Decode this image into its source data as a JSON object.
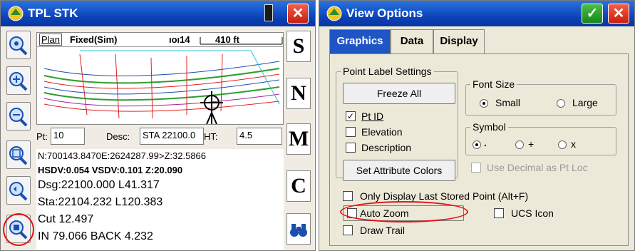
{
  "left": {
    "title": "TPL STK",
    "close_label": "✕",
    "map": {
      "plan_tab": "Plan",
      "fix_status": "Fixed(Sim)",
      "satellites": "14",
      "scale": "410 ft"
    },
    "fields": {
      "pt_label": "Pt:",
      "pt_value": "10",
      "desc_label": "Desc:",
      "desc_value": "STA 22100.0",
      "ht_label": "HT:",
      "ht_value": "4.5"
    },
    "info_lines": [
      "N:700143.8470E:2624287.99>Z:32.5866",
      "HSDV:0.054 VSDV:0.101 Z:20.090",
      "Dsg:22100.000 L41.317",
      "Sta:22104.232 L120.383",
      "Cut 12.497",
      "IN 79.066 BACK 4.232"
    ],
    "right_buttons": [
      "S",
      "N",
      "M",
      "C"
    ],
    "side_icons": [
      "zoom-extents-icon",
      "zoom-in-icon",
      "zoom-out-icon",
      "zoom-window-icon",
      "zoom-previous-icon",
      "auto-zoom-icon"
    ],
    "highlight_color": "#e0141a"
  },
  "right": {
    "title": "View Options",
    "ok_label": "✓",
    "close_label": "✕",
    "tabs": [
      "Graphics",
      "Data",
      "Display"
    ],
    "point_label_settings": {
      "label": "Point Label Settings",
      "freeze_all": "Freeze All",
      "pt_id": "Pt ID",
      "pt_id_checked": true,
      "elevation": "Elevation",
      "description": "Description",
      "set_attribute_colors": "Set Attribute Colors"
    },
    "font_size": {
      "label": "Font Size",
      "small": "Small",
      "large": "Large",
      "selected": "Small"
    },
    "symbol": {
      "label": "Symbol",
      "options": [
        ".",
        "+",
        "x"
      ],
      "selected": "."
    },
    "use_decimal": "Use Decimal as Pt Loc",
    "only_display_last": "Only Display Last Stored Point (Alt+F)",
    "auto_zoom": "Auto Zoom",
    "ucs_icon": "UCS Icon",
    "draw_trail": "Draw Trail"
  }
}
